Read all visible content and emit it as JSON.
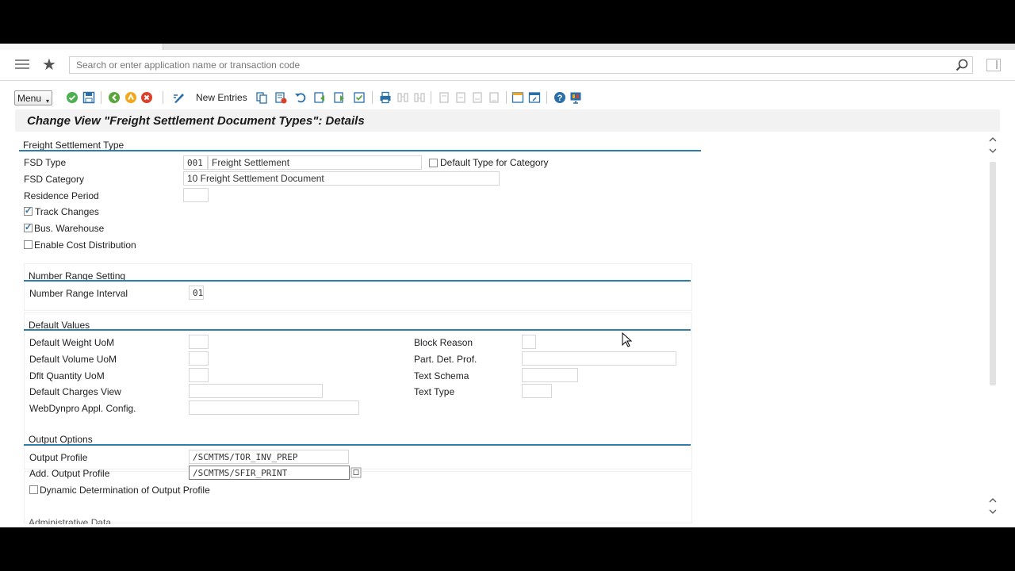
{
  "shell": {
    "search_placeholder": "Search or enter application name or transaction code"
  },
  "toolbar": {
    "menu_label": "Menu",
    "new_entries_label": "New Entries"
  },
  "page": {
    "title": "Change View \"Freight Settlement Document Types\": Details"
  },
  "freight_settlement_type": {
    "group_title": "Freight Settlement Type",
    "fsd_type_label": "FSD Type",
    "fsd_type_code": "001",
    "fsd_type_desc": "Freight Settlement",
    "default_type_label": "Default Type for Category",
    "default_type_checked": false,
    "fsd_category_label": "FSD Category",
    "fsd_category_value": "10 Freight Settlement Document",
    "residence_period_label": "Residence Period",
    "residence_period_value": "",
    "track_changes_label": "Track Changes",
    "track_changes_checked": true,
    "bus_warehouse_label": "Bus. Warehouse",
    "bus_warehouse_checked": true,
    "cost_distribution_label": "Enable Cost Distribution",
    "cost_distribution_checked": false
  },
  "number_range": {
    "group_title": "Number Range Setting",
    "interval_label": "Number Range Interval",
    "interval_value": "01"
  },
  "default_values": {
    "group_title": "Default Values",
    "weight_uom_label": "Default Weight UoM",
    "volume_uom_label": "Default Volume UoM",
    "quantity_uom_label": "Dflt Quantity UoM",
    "charges_view_label": "Default Charges View",
    "webdynpro_label": "WebDynpro Appl. Config.",
    "block_reason_label": "Block Reason",
    "part_det_label": "Part. Det. Prof.",
    "text_schema_label": "Text Schema",
    "text_type_label": "Text Type"
  },
  "output_options": {
    "group_title": "Output Options",
    "output_profile_label": "Output Profile",
    "output_profile_value": "/SCMTMS/TOR_INV_PREP",
    "add_output_profile_label": "Add. Output Profile",
    "add_output_profile_value": "/SCMTMS/SFIR_PRINT",
    "dynamic_label": "Dynamic Determination of Output Profile",
    "dynamic_checked": false
  },
  "next_group_title": "Administrative Data",
  "colors": {
    "accent_line": "#2e7dab",
    "title_bg": "#f2f2f2"
  }
}
